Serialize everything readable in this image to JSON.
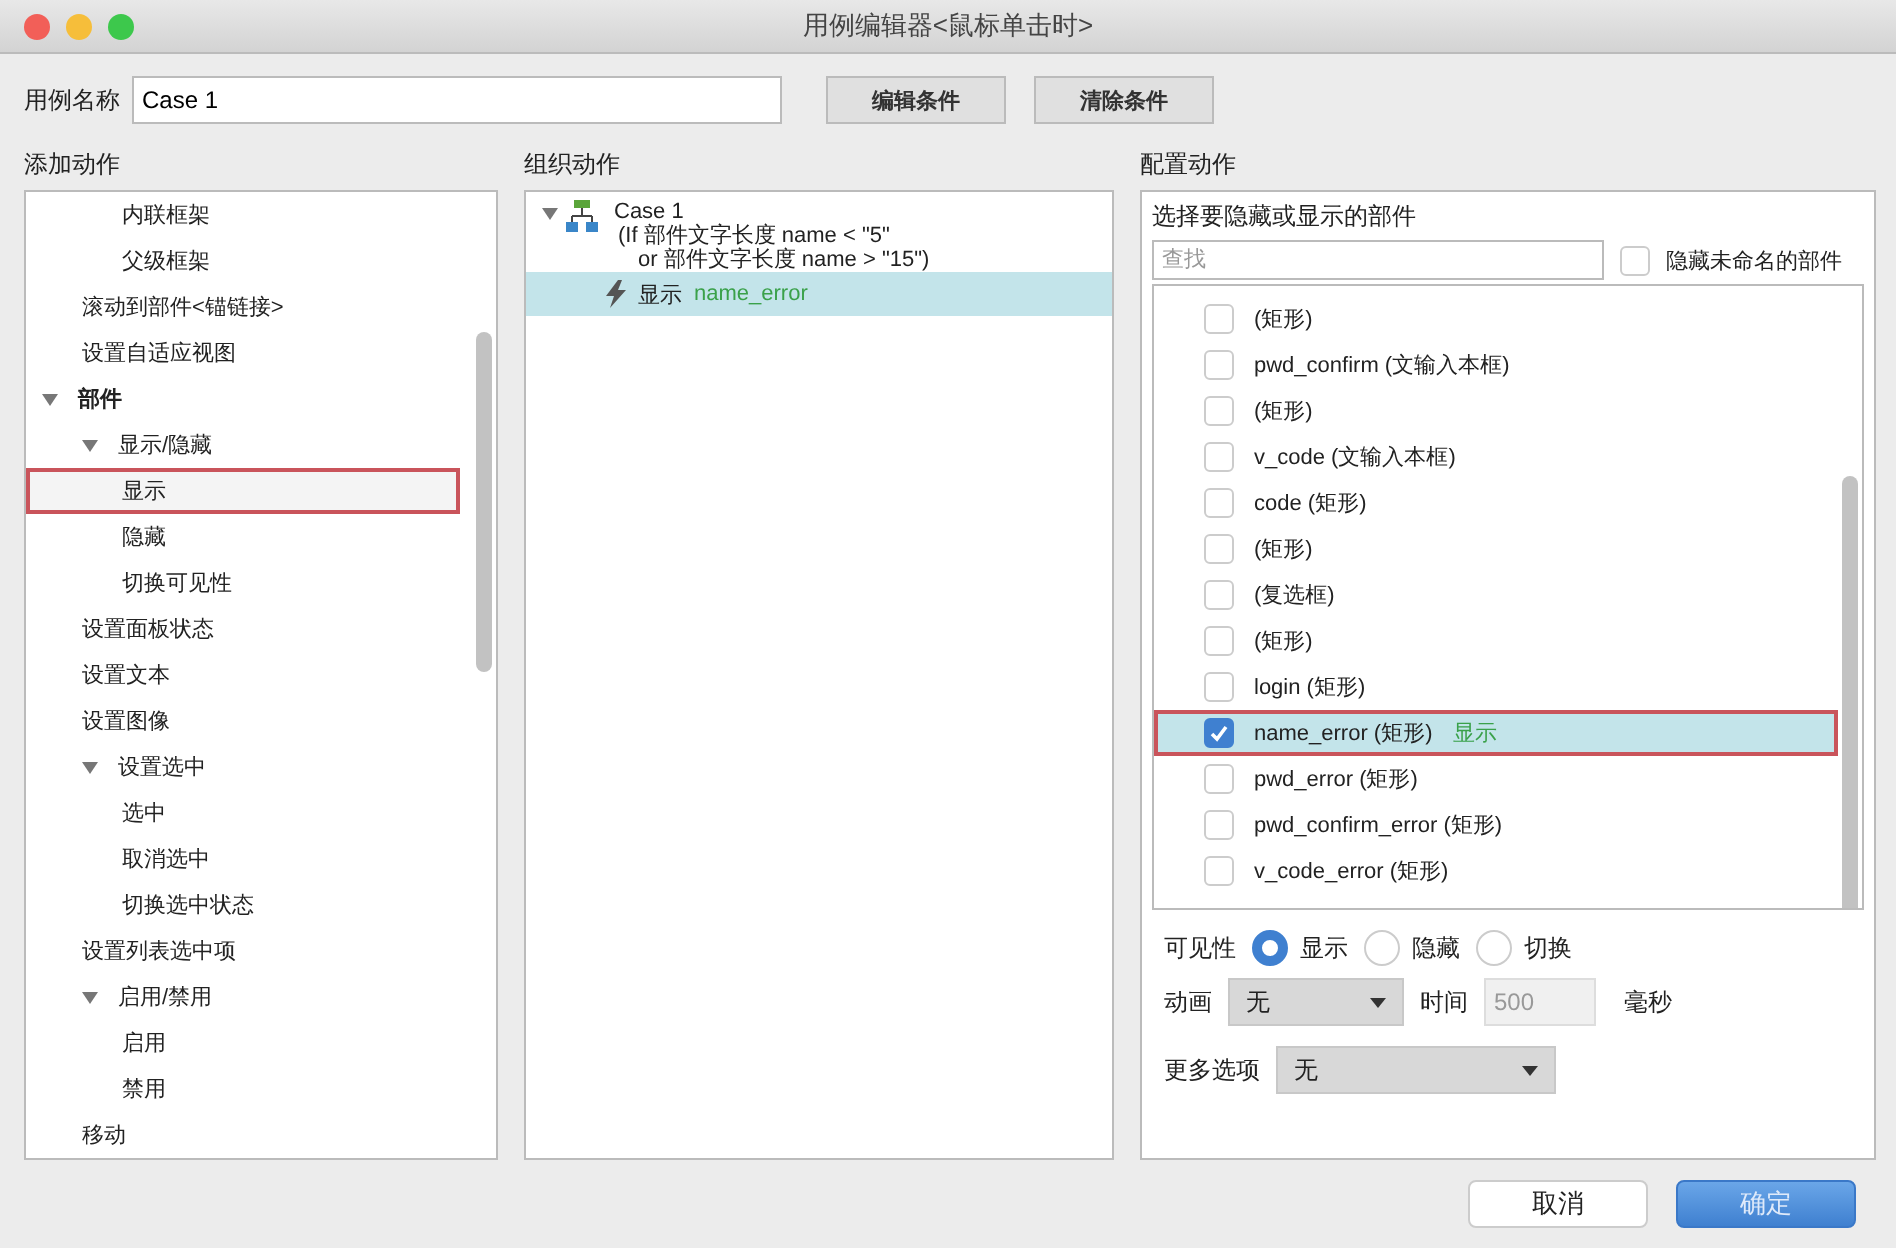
{
  "window": {
    "title": "用例编辑器<鼠标单击时>"
  },
  "case_name": {
    "label": "用例名称",
    "value": "Case 1"
  },
  "top_buttons": [
    "编辑条件",
    "清除条件"
  ],
  "add_actions": {
    "heading": "添加动作",
    "tree": [
      {
        "children": [
          {
            "children": [
              {
                "label": "内联框架",
                "selected": false
              },
              {
                "label": "父级框架",
                "selected": false
              }
            ]
          },
          {
            "label": "滚动到部件<锚链接>",
            "selected": false
          },
          {
            "label": "设置自适应视图",
            "selected": false
          }
        ]
      },
      {
        "label": "部件",
        "expanded": true,
        "selected": false,
        "children": [
          {
            "label": "显示/隐藏",
            "expanded": true,
            "selected": false,
            "children": [
              {
                "label": "显示",
                "selected": true
              },
              {
                "label": "隐藏",
                "selected": false
              },
              {
                "label": "切换可见性",
                "selected": false
              }
            ]
          },
          {
            "label": "设置面板状态",
            "selected": false
          },
          {
            "label": "设置文本",
            "selected": false
          },
          {
            "label": "设置图像",
            "selected": false
          },
          {
            "label": "设置选中",
            "expanded": true,
            "selected": false,
            "children": [
              {
                "label": "选中",
                "selected": false
              },
              {
                "label": "取消选中",
                "selected": false
              },
              {
                "label": "切换选中状态",
                "selected": false
              }
            ]
          },
          {
            "label": "设置列表选中项",
            "selected": false
          },
          {
            "label": "启用/禁用",
            "expanded": true,
            "selected": false,
            "children": [
              {
                "label": "启用",
                "selected": false
              },
              {
                "label": "禁用",
                "selected": false
              }
            ]
          },
          {
            "label": "移动",
            "selected": false
          }
        ]
      }
    ]
  },
  "organize_actions": {
    "heading": "组织动作",
    "case": {
      "label": "Case 1",
      "expanded": true,
      "condition": [
        "(If 部件文字长度 name < \"5\"",
        "or 部件文字长度 name > \"15\")"
      ],
      "actions": [
        {
          "verb": "显示",
          "target": "name_error",
          "selected": true
        }
      ]
    }
  },
  "configure_actions": {
    "heading": "配置动作",
    "subheading": "选择要隐藏或显示的部件",
    "search": {
      "placeholder": "查找"
    },
    "hide_unnamed": {
      "label": "隐藏未命名的部件",
      "checked": false
    },
    "widgets": [
      {
        "label": "(矩形)",
        "checked": false,
        "selected": false
      },
      {
        "label": "pwd_confirm (文输入本框)",
        "checked": false,
        "selected": false
      },
      {
        "label": "(矩形)",
        "checked": false,
        "selected": false
      },
      {
        "label": "v_code (文输入本框)",
        "checked": false,
        "selected": false
      },
      {
        "label": "code (矩形)",
        "checked": false,
        "selected": false
      },
      {
        "label": "(矩形)",
        "checked": false,
        "selected": false
      },
      {
        "label": "(复选框)",
        "checked": false,
        "selected": false
      },
      {
        "label": "(矩形)",
        "checked": false,
        "selected": false
      },
      {
        "label": "login (矩形)",
        "checked": false,
        "selected": false
      },
      {
        "label": "name_error (矩形)",
        "checked": true,
        "selected": true,
        "action": "显示"
      },
      {
        "label": "pwd_error (矩形)",
        "checked": false,
        "selected": false
      },
      {
        "label": "pwd_confirm_error (矩形)",
        "checked": false,
        "selected": false
      },
      {
        "label": "v_code_error (矩形)",
        "checked": false,
        "selected": false
      }
    ],
    "visibility": {
      "label": "可见性",
      "options": [
        {
          "label": "显示",
          "selected": true
        },
        {
          "label": "隐藏",
          "selected": false
        },
        {
          "label": "切换",
          "selected": false
        }
      ]
    },
    "animation": {
      "label": "动画",
      "value": "无",
      "time_label": "时间",
      "time_value": "500",
      "unit": "毫秒"
    },
    "more_options": {
      "label": "更多选项",
      "value": "无"
    }
  },
  "footer_buttons": [
    {
      "label": "取消",
      "kind": "secondary"
    },
    {
      "label": "确定",
      "kind": "primary"
    }
  ]
}
